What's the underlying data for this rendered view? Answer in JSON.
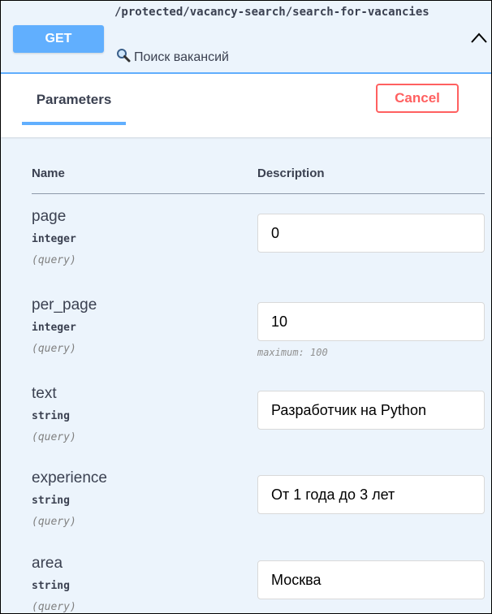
{
  "operation": {
    "method": "GET",
    "path": "/protected/vacancy-search/search-for-vacancies",
    "summary": "Поиск вакансий"
  },
  "tabs": {
    "parameters_label": "Parameters"
  },
  "actions": {
    "cancel_label": "Cancel"
  },
  "table": {
    "name_header": "Name",
    "description_header": "Description"
  },
  "parameters": [
    {
      "name": "page",
      "type": "integer",
      "in": "(query)",
      "value": "0",
      "note": ""
    },
    {
      "name": "per_page",
      "type": "integer",
      "in": "(query)",
      "value": "10",
      "note": "maximum: 100"
    },
    {
      "name": "text",
      "type": "string",
      "in": "(query)",
      "value": "Разработчик на Python",
      "note": ""
    },
    {
      "name": "experience",
      "type": "string",
      "in": "(query)",
      "value": "От 1 года до 3 лет",
      "note": ""
    },
    {
      "name": "area",
      "type": "string",
      "in": "(query)",
      "value": "Москва",
      "note": ""
    }
  ],
  "colors": {
    "get_blue": "#61affe",
    "background_tint": "#ecf4fc",
    "cancel_red": "#ff6060"
  },
  "icons": {
    "summary_icon": "magnifier-icon",
    "collapse_icon": "chevron-up-icon"
  }
}
